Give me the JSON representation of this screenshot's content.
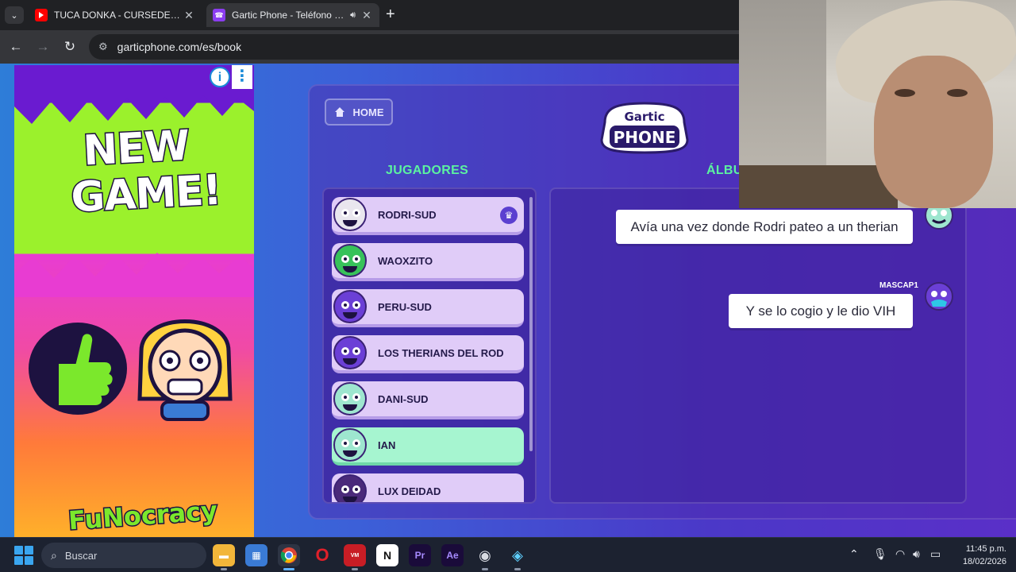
{
  "browser": {
    "tabs": [
      {
        "title": "TUCA DONKA - CURSEDEVIL, D",
        "favicon": "youtube-icon",
        "active": false
      },
      {
        "title": "Gartic Phone - Teléfono De",
        "favicon": "gartic-phone-icon",
        "active": true
      }
    ],
    "url": "garticphone.com/es/book"
  },
  "ad": {
    "headline_line1": "NEW",
    "headline_line2": "GAME!",
    "brand": "FuNocracy"
  },
  "game": {
    "home_label": "HOME",
    "logo_top": "Gartic",
    "logo_bottom": "PHONE",
    "players_title": "JUGADORES",
    "album_title": "ÁLBU",
    "players": [
      {
        "name": "RODRI-SUD",
        "host": true,
        "color": "#e9e6ee",
        "current": false
      },
      {
        "name": "WAOXZITO",
        "host": false,
        "color": "#37c25a",
        "current": false
      },
      {
        "name": "PERU-SUD",
        "host": false,
        "color": "#6b3fd6",
        "current": false
      },
      {
        "name": "LOS THERIANS DEL ROD",
        "host": false,
        "color": "#6b3fd6",
        "current": false
      },
      {
        "name": "DANI-SUD",
        "host": false,
        "color": "#9ee6cf",
        "current": false
      },
      {
        "name": "IAN",
        "host": false,
        "color": "#9ee6cf",
        "current": true
      },
      {
        "name": "LUX DEIDAD",
        "host": false,
        "color": "#4a2a7a",
        "current": false
      }
    ],
    "album": {
      "messages": [
        {
          "author": "",
          "text": "Avía una vez donde Rodri pateo a un therian"
        },
        {
          "author": "MASCAP1",
          "text": "Y se lo cogio y le dio VIH"
        }
      ]
    }
  },
  "taskbar": {
    "search_placeholder": "Buscar",
    "apps": [
      "file-explorer-icon",
      "microsoft-store-icon",
      "chrome-icon",
      "opera-icon",
      "voicemeeter-icon",
      "notion-icon",
      "premiere-pro-icon",
      "after-effects-icon",
      "obs-icon",
      "app-icon"
    ],
    "time": "11:45 p.m.",
    "date": "18/02/2026"
  },
  "colors": {
    "accent_green": "#5cf2a0",
    "player_card": "#e0ccf8",
    "player_current": "#a6f5d0"
  }
}
